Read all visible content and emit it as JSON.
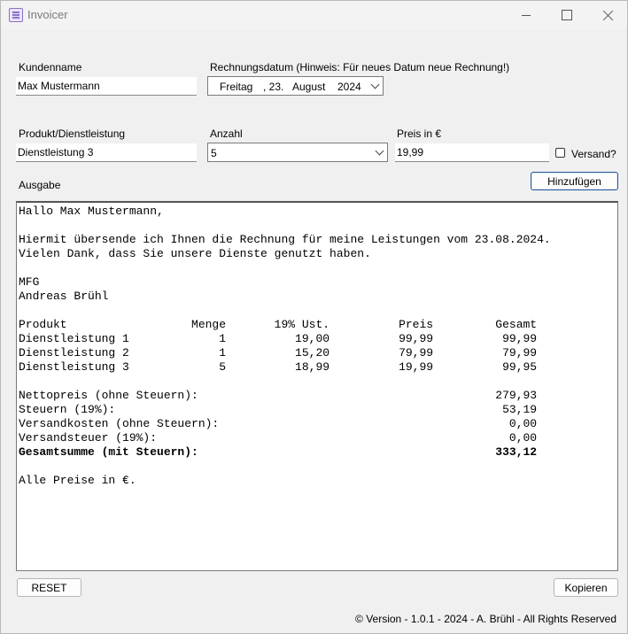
{
  "window": {
    "title": "Invoicer"
  },
  "customer": {
    "label": "Kundenname",
    "value": "Max Mustermann"
  },
  "date": {
    "label": "Rechnungsdatum (Hinweis: Für neues Datum neue Rechnung!)",
    "weekday": "Freitag",
    "day": ", 23.",
    "month": "August",
    "year": "2024"
  },
  "product": {
    "label": "Produkt/Dienstleistung",
    "value": "Dienstleistung 3"
  },
  "quantity": {
    "label": "Anzahl",
    "value": "5"
  },
  "price": {
    "label": "Preis in €",
    "value": "19,99"
  },
  "shipping": {
    "label": "Versand?",
    "checked": false
  },
  "add_button": "Hinzufügen",
  "output": {
    "label": "Ausgabe",
    "lines": [
      {
        "text": "Hallo Max Mustermann,",
        "bold": false
      },
      {
        "text": "",
        "bold": false
      },
      {
        "text": "Hiermit übersende ich Ihnen die Rechnung für meine Leistungen vom 23.08.2024.",
        "bold": false
      },
      {
        "text": "Vielen Dank, dass Sie unsere Dienste genutzt haben.",
        "bold": false
      },
      {
        "text": "",
        "bold": false
      },
      {
        "text": "MFG",
        "bold": false
      },
      {
        "text": "Andreas Brühl",
        "bold": false
      },
      {
        "text": "",
        "bold": false
      },
      {
        "text": "Produkt                  Menge       19% Ust.          Preis         Gesamt",
        "bold": false
      },
      {
        "text": "Dienstleistung 1             1          19,00          99,99          99,99",
        "bold": false
      },
      {
        "text": "Dienstleistung 2             1          15,20          79,99          79,99",
        "bold": false
      },
      {
        "text": "Dienstleistung 3             5          18,99          19,99          99,95",
        "bold": false
      },
      {
        "text": "",
        "bold": false
      },
      {
        "text": "Nettopreis (ohne Steuern):                                           279,93",
        "bold": false
      },
      {
        "text": "Steuern (19%):                                                        53,19",
        "bold": false
      },
      {
        "text": "Versandkosten (ohne Steuern):                                          0,00",
        "bold": false
      },
      {
        "text": "Versandsteuer (19%):                                                   0,00",
        "bold": false
      },
      {
        "text": "Gesamtsumme (mit Steuern):                                           333,12",
        "bold": true
      },
      {
        "text": "",
        "bold": false
      },
      {
        "text": "Alle Preise in €.",
        "bold": false
      }
    ]
  },
  "reset_button": "RESET",
  "copy_button": "Kopieren",
  "footer": "© Version - 1.0.1 - 2024 - A. Brühl - All Rights Reserved"
}
